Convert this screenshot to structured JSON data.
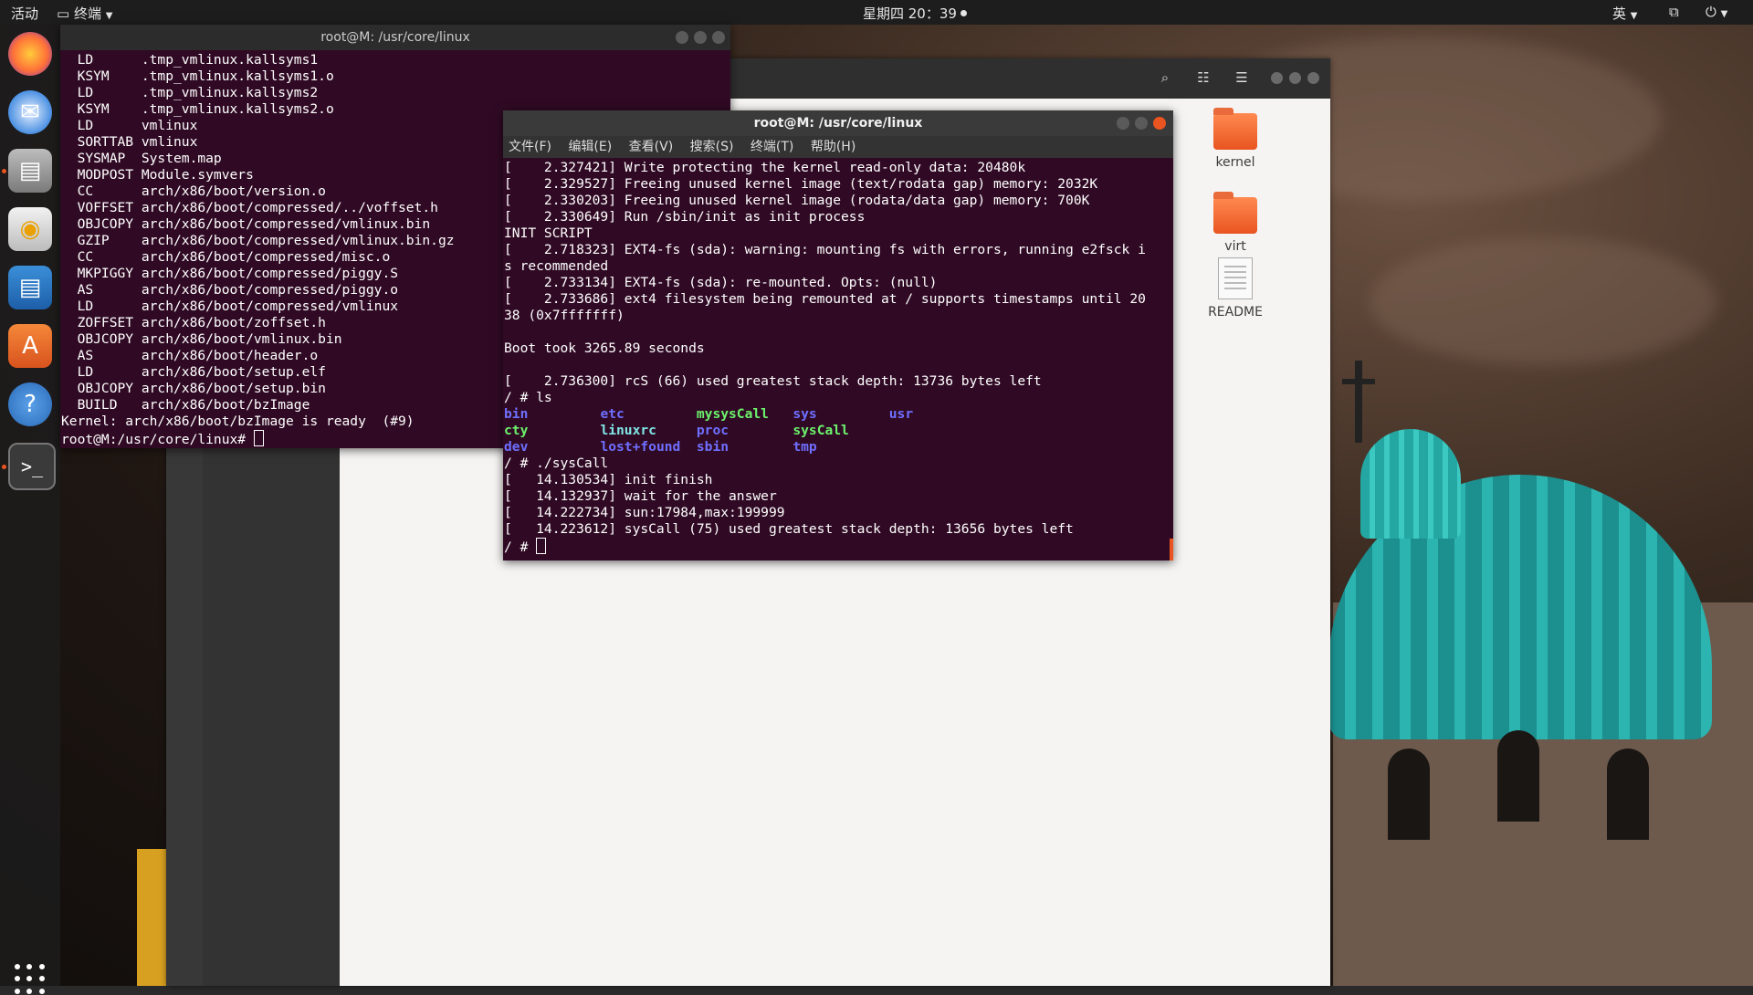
{
  "topbar": {
    "activities": "活动",
    "app_menu": "终端",
    "clock": "星期四 20：39",
    "ime": "英"
  },
  "dock": {
    "items": [
      "firefox-icon",
      "thunderbird-icon",
      "files-icon",
      "rhythmbox-icon",
      "writer-icon",
      "software-icon",
      "help-icon",
      "terminal-icon"
    ]
  },
  "files": {
    "items": [
      {
        "label": "kernel",
        "type": "folder"
      },
      {
        "label": "virt",
        "type": "folder"
      },
      {
        "label": "README",
        "type": "document"
      }
    ]
  },
  "term1": {
    "title": "root@M: /usr/core/linux",
    "lines": [
      "  LD      .tmp_vmlinux.kallsyms1",
      "  KSYM    .tmp_vmlinux.kallsyms1.o",
      "  LD      .tmp_vmlinux.kallsyms2",
      "  KSYM    .tmp_vmlinux.kallsyms2.o",
      "  LD      vmlinux",
      "  SORTTAB vmlinux",
      "  SYSMAP  System.map",
      "  MODPOST Module.symvers",
      "  CC      arch/x86/boot/version.o",
      "  VOFFSET arch/x86/boot/compressed/../voffset.h",
      "  OBJCOPY arch/x86/boot/compressed/vmlinux.bin",
      "  GZIP    arch/x86/boot/compressed/vmlinux.bin.gz",
      "  CC      arch/x86/boot/compressed/misc.o",
      "  MKPIGGY arch/x86/boot/compressed/piggy.S",
      "  AS      arch/x86/boot/compressed/piggy.o",
      "  LD      arch/x86/boot/compressed/vmlinux",
      "  ZOFFSET arch/x86/boot/zoffset.h",
      "  OBJCOPY arch/x86/boot/vmlinux.bin",
      "  AS      arch/x86/boot/header.o",
      "  LD      arch/x86/boot/setup.elf",
      "  OBJCOPY arch/x86/boot/setup.bin",
      "  BUILD   arch/x86/boot/bzImage",
      "Kernel: arch/x86/boot/bzImage is ready  (#9)"
    ],
    "prompt": "root@M:/usr/core/linux# "
  },
  "term2": {
    "title": "root@M: /usr/core/linux",
    "menu": [
      "文件(F)",
      "编辑(E)",
      "查看(V)",
      "搜索(S)",
      "终端(T)",
      "帮助(H)"
    ],
    "lines_before_ls": [
      "[    2.327421] Write protecting the kernel read-only data: 20480k",
      "[    2.329527] Freeing unused kernel image (text/rodata gap) memory: 2032K",
      "[    2.330203] Freeing unused kernel image (rodata/data gap) memory: 700K",
      "[    2.330649] Run /sbin/init as init process",
      "INIT SCRIPT",
      "[    2.718323] EXT4-fs (sda): warning: mounting fs with errors, running e2fsck i",
      "s recommended",
      "[    2.733134] EXT4-fs (sda): re-mounted. Opts: (null)",
      "[    2.733686] ext4 filesystem being remounted at / supports timestamps until 20",
      "38 (0x7fffffff)",
      "",
      "Boot took 3265.89 seconds",
      "",
      "[    2.736300] rcS (66) used greatest stack depth: 13736 bytes left",
      "/ # ls"
    ],
    "ls_rows": [
      [
        {
          "t": "bin",
          "c": "dir"
        },
        {
          "t": "etc",
          "c": "dir"
        },
        {
          "t": "mysysCall",
          "c": "exe"
        },
        {
          "t": "sys",
          "c": "dir"
        },
        {
          "t": "usr",
          "c": "dir"
        }
      ],
      [
        {
          "t": "cty",
          "c": "exe"
        },
        {
          "t": "linuxrc",
          "c": "link"
        },
        {
          "t": "proc",
          "c": "dir"
        },
        {
          "t": "sysCall",
          "c": "exe"
        },
        {
          "t": "",
          "c": "dir"
        }
      ],
      [
        {
          "t": "dev",
          "c": "dir"
        },
        {
          "t": "lost+found",
          "c": "dir"
        },
        {
          "t": "sbin",
          "c": "dir"
        },
        {
          "t": "tmp",
          "c": "dir"
        },
        {
          "t": "",
          "c": "dir"
        }
      ]
    ],
    "lines_after_ls": [
      "/ # ./sysCall",
      "[   14.130534] init finish",
      "[   14.132937] wait for the answer",
      "[   14.222734] sun:17984,max:199999",
      "[   14.223612] sysCall (75) used greatest stack depth: 13656 bytes left"
    ],
    "prompt": "/ # "
  }
}
